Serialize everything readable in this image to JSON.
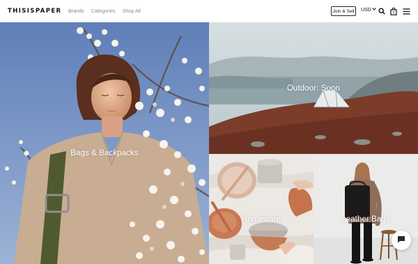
{
  "header": {
    "logo": "THISISPAPER",
    "nav": [
      {
        "label": "Brands"
      },
      {
        "label": "Categories"
      },
      {
        "label": "Shop All"
      }
    ],
    "join_button": "Join & Sell",
    "currency": "USD",
    "icons": [
      "search-icon",
      "cart-icon",
      "menu-icon"
    ]
  },
  "tiles": {
    "bags": {
      "label": "Bags & Backpacks"
    },
    "outdoor": {
      "label": "Outdoor: Soon"
    },
    "homeware": {
      "label": "Homeware"
    },
    "leather": {
      "label": "Leather Bags"
    }
  },
  "chat": {
    "icon": "chat-icon"
  },
  "colors": {
    "sky": "#6f8fc4",
    "outdoor_sky": "#c9d4d8",
    "heather": "#7a3a28",
    "homeware_bg": "#ece8e4",
    "terracotta": "#c97a5a",
    "leather_bg": "#ebebe9"
  },
  "cart_count": "0"
}
